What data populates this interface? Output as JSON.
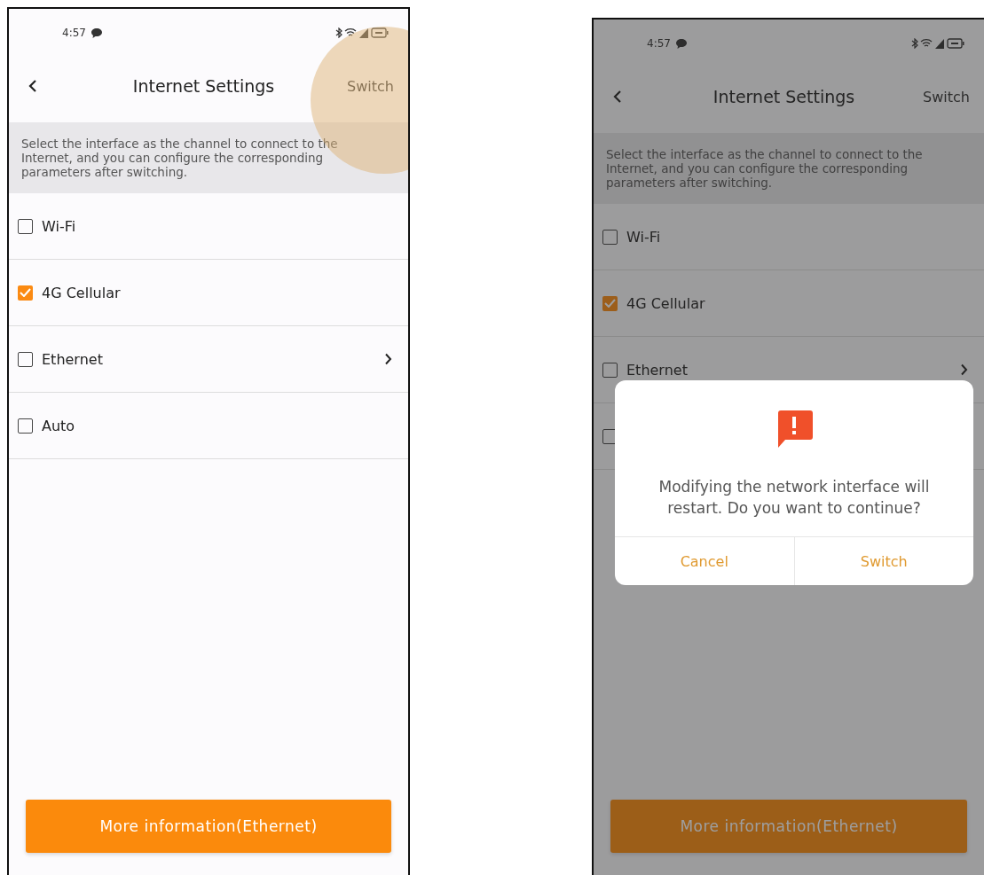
{
  "screens": [
    {
      "dimmed": false,
      "touch_indicator": true,
      "status_bar": {
        "time": "4:57"
      },
      "header": {
        "title": "Internet Settings",
        "action": "Switch"
      },
      "description": "Select the interface as the channel to connect to the Internet, and you can configure the corresponding parameters after switching.",
      "options": [
        {
          "label": "Wi-Fi",
          "checked": false,
          "has_arrow": false
        },
        {
          "label": "4G Cellular",
          "checked": true,
          "has_arrow": false
        },
        {
          "label": "Ethernet",
          "checked": false,
          "has_arrow": true
        },
        {
          "label": "Auto",
          "checked": false,
          "has_arrow": false
        }
      ],
      "button": "More information(Ethernet)"
    },
    {
      "dimmed": true,
      "touch_indicator": false,
      "status_bar": {
        "time": "4:57"
      },
      "header": {
        "title": "Internet Settings",
        "action": "Switch"
      },
      "description": "Select the interface as the channel to connect to the Internet, and you can configure the corresponding parameters after switching.",
      "options": [
        {
          "label": "Wi-Fi",
          "checked": false,
          "has_arrow": false
        },
        {
          "label": "4G Cellular",
          "checked": true,
          "has_arrow": false
        },
        {
          "label": "Ethernet",
          "checked": false,
          "has_arrow": true
        },
        {
          "checked": false
        }
      ],
      "button": "More information(Ethernet)",
      "dialog": {
        "message": "Modifying the network interface will restart. Do you want to continue?",
        "buttons": [
          "Cancel",
          "Switch"
        ]
      }
    }
  ]
}
